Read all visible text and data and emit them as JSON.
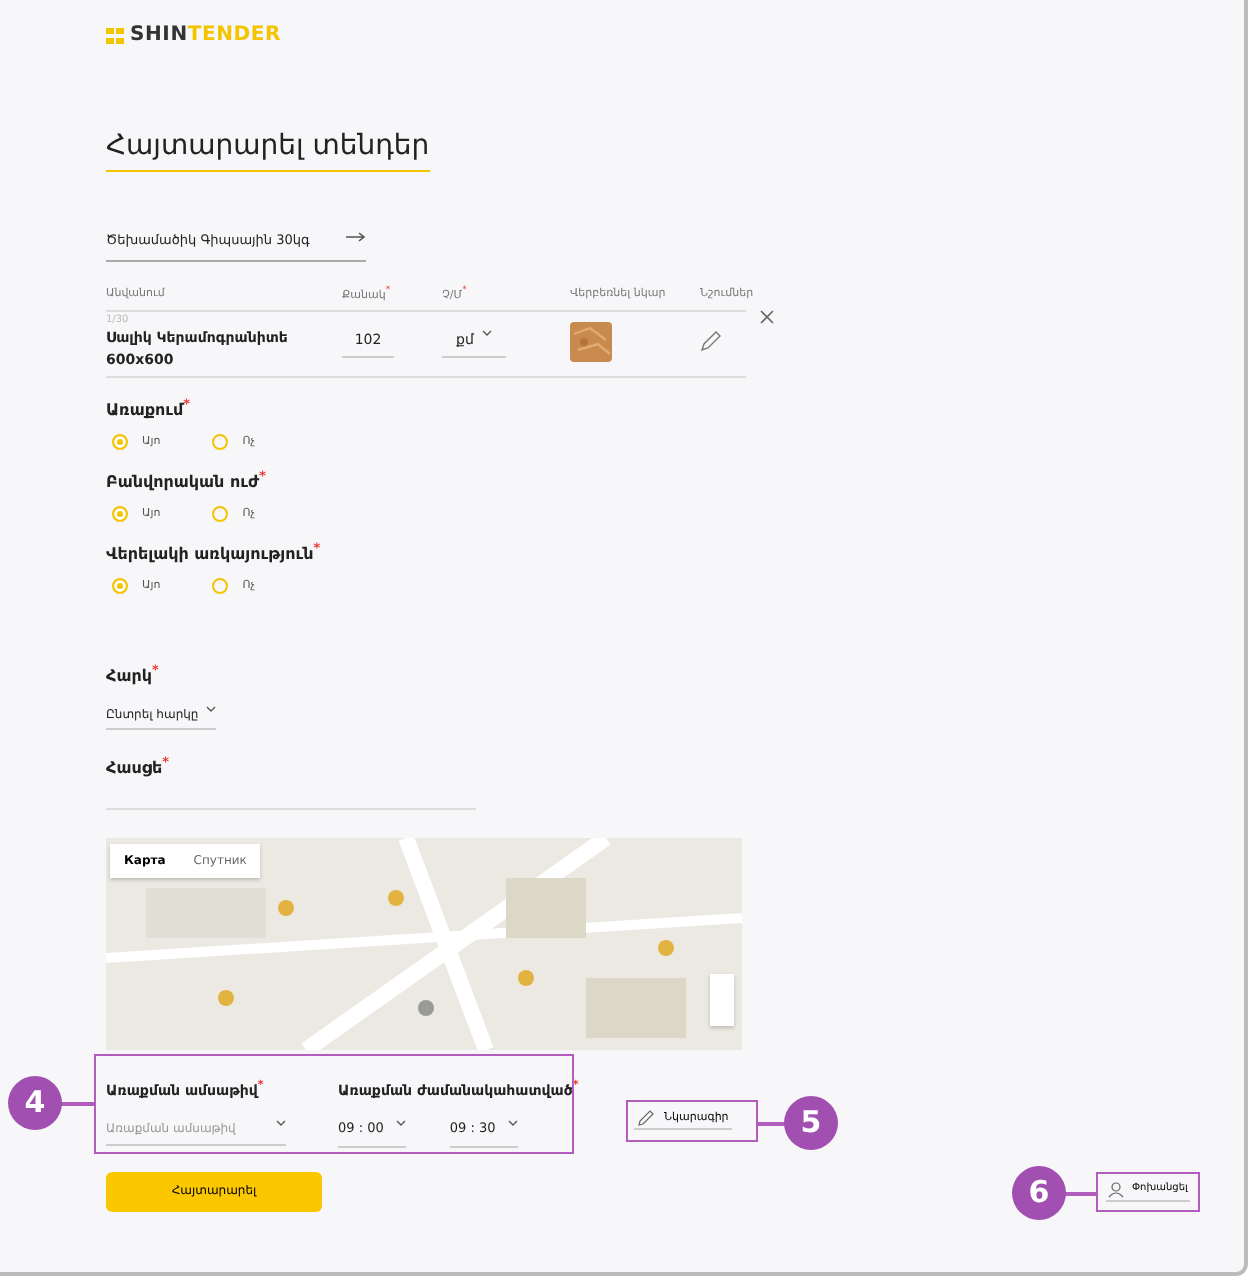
{
  "logo": {
    "part_1": "SHIN",
    "part_2": "TENDER"
  },
  "title": "Հայտարարել տենդեր",
  "address_field": {
    "value": "Ծեխամածիկ Գիպսային 30կգ"
  },
  "table": {
    "columns": [
      {
        "label": "Անվանում"
      },
      {
        "label": "Քանակ",
        "required_mark": "*"
      },
      {
        "label": "Չ/Մ",
        "required_mark": "*"
      },
      {
        "label": "Վերբեռնել նկար"
      },
      {
        "label": "Նշումներ"
      }
    ],
    "rows": [
      {
        "index": "1/30",
        "name": "Սալիկ Կերամոգրանիտե 600x600",
        "quantity": "102",
        "unit": "քմ"
      }
    ]
  },
  "radio_groups": [
    {
      "label": "Առաքում",
      "required_mark": "*",
      "options": [
        {
          "label": "Այո",
          "selected": true
        },
        {
          "label": "Ոչ",
          "selected": false
        }
      ]
    },
    {
      "label": "Բանվորական ուժ",
      "required_mark": "*",
      "options": [
        {
          "label": "Այո",
          "selected": true
        },
        {
          "label": "Ոչ",
          "selected": false
        }
      ]
    },
    {
      "label": "Վերելակի առկայություն",
      "required_mark": "*",
      "options": [
        {
          "label": "Այո",
          "selected": true
        },
        {
          "label": "Ոչ",
          "selected": false
        }
      ]
    }
  ],
  "floor": {
    "label": "Հարկ",
    "required_mark": "*",
    "value": "Ընտրել հարկը"
  },
  "address": {
    "label": "Հասցե",
    "required_mark": "*"
  },
  "map": {
    "tabs": [
      {
        "label": "Карта",
        "selected": true
      },
      {
        "label": "Спутник",
        "selected": false
      }
    ]
  },
  "delivery_date": {
    "label": "Առաքման ամսաթիվ",
    "required_mark": "*",
    "placeholder": "Առաքման ամսաթիվ"
  },
  "delivery_time": {
    "label": "Առաքման ժամանակահատված",
    "required_mark": "*",
    "from": {
      "hour": "09",
      "separator": ":",
      "minute": "00"
    },
    "to": {
      "hour": "09",
      "separator": ":",
      "minute": "30"
    }
  },
  "description_link": "Նկարագիր",
  "submit_button": "Հայտարարել",
  "profile_link": "Փոխանցել",
  "callouts": [
    "4",
    "5",
    "6"
  ]
}
